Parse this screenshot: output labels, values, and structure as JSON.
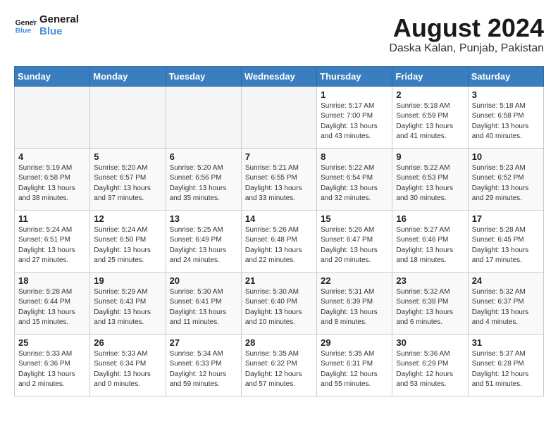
{
  "header": {
    "logo_text_general": "General",
    "logo_text_blue": "Blue",
    "month_year": "August 2024",
    "location": "Daska Kalan, Punjab, Pakistan"
  },
  "days_of_week": [
    "Sunday",
    "Monday",
    "Tuesday",
    "Wednesday",
    "Thursday",
    "Friday",
    "Saturday"
  ],
  "weeks": [
    [
      {
        "num": "",
        "info": ""
      },
      {
        "num": "",
        "info": ""
      },
      {
        "num": "",
        "info": ""
      },
      {
        "num": "",
        "info": ""
      },
      {
        "num": "1",
        "info": "Sunrise: 5:17 AM\nSunset: 7:00 PM\nDaylight: 13 hours\nand 43 minutes."
      },
      {
        "num": "2",
        "info": "Sunrise: 5:18 AM\nSunset: 6:59 PM\nDaylight: 13 hours\nand 41 minutes."
      },
      {
        "num": "3",
        "info": "Sunrise: 5:18 AM\nSunset: 6:58 PM\nDaylight: 13 hours\nand 40 minutes."
      }
    ],
    [
      {
        "num": "4",
        "info": "Sunrise: 5:19 AM\nSunset: 6:58 PM\nDaylight: 13 hours\nand 38 minutes."
      },
      {
        "num": "5",
        "info": "Sunrise: 5:20 AM\nSunset: 6:57 PM\nDaylight: 13 hours\nand 37 minutes."
      },
      {
        "num": "6",
        "info": "Sunrise: 5:20 AM\nSunset: 6:56 PM\nDaylight: 13 hours\nand 35 minutes."
      },
      {
        "num": "7",
        "info": "Sunrise: 5:21 AM\nSunset: 6:55 PM\nDaylight: 13 hours\nand 33 minutes."
      },
      {
        "num": "8",
        "info": "Sunrise: 5:22 AM\nSunset: 6:54 PM\nDaylight: 13 hours\nand 32 minutes."
      },
      {
        "num": "9",
        "info": "Sunrise: 5:22 AM\nSunset: 6:53 PM\nDaylight: 13 hours\nand 30 minutes."
      },
      {
        "num": "10",
        "info": "Sunrise: 5:23 AM\nSunset: 6:52 PM\nDaylight: 13 hours\nand 29 minutes."
      }
    ],
    [
      {
        "num": "11",
        "info": "Sunrise: 5:24 AM\nSunset: 6:51 PM\nDaylight: 13 hours\nand 27 minutes."
      },
      {
        "num": "12",
        "info": "Sunrise: 5:24 AM\nSunset: 6:50 PM\nDaylight: 13 hours\nand 25 minutes."
      },
      {
        "num": "13",
        "info": "Sunrise: 5:25 AM\nSunset: 6:49 PM\nDaylight: 13 hours\nand 24 minutes."
      },
      {
        "num": "14",
        "info": "Sunrise: 5:26 AM\nSunset: 6:48 PM\nDaylight: 13 hours\nand 22 minutes."
      },
      {
        "num": "15",
        "info": "Sunrise: 5:26 AM\nSunset: 6:47 PM\nDaylight: 13 hours\nand 20 minutes."
      },
      {
        "num": "16",
        "info": "Sunrise: 5:27 AM\nSunset: 6:46 PM\nDaylight: 13 hours\nand 18 minutes."
      },
      {
        "num": "17",
        "info": "Sunrise: 5:28 AM\nSunset: 6:45 PM\nDaylight: 13 hours\nand 17 minutes."
      }
    ],
    [
      {
        "num": "18",
        "info": "Sunrise: 5:28 AM\nSunset: 6:44 PM\nDaylight: 13 hours\nand 15 minutes."
      },
      {
        "num": "19",
        "info": "Sunrise: 5:29 AM\nSunset: 6:43 PM\nDaylight: 13 hours\nand 13 minutes."
      },
      {
        "num": "20",
        "info": "Sunrise: 5:30 AM\nSunset: 6:41 PM\nDaylight: 13 hours\nand 11 minutes."
      },
      {
        "num": "21",
        "info": "Sunrise: 5:30 AM\nSunset: 6:40 PM\nDaylight: 13 hours\nand 10 minutes."
      },
      {
        "num": "22",
        "info": "Sunrise: 5:31 AM\nSunset: 6:39 PM\nDaylight: 13 hours\nand 8 minutes."
      },
      {
        "num": "23",
        "info": "Sunrise: 5:32 AM\nSunset: 6:38 PM\nDaylight: 13 hours\nand 6 minutes."
      },
      {
        "num": "24",
        "info": "Sunrise: 5:32 AM\nSunset: 6:37 PM\nDaylight: 13 hours\nand 4 minutes."
      }
    ],
    [
      {
        "num": "25",
        "info": "Sunrise: 5:33 AM\nSunset: 6:36 PM\nDaylight: 13 hours\nand 2 minutes."
      },
      {
        "num": "26",
        "info": "Sunrise: 5:33 AM\nSunset: 6:34 PM\nDaylight: 13 hours\nand 0 minutes."
      },
      {
        "num": "27",
        "info": "Sunrise: 5:34 AM\nSunset: 6:33 PM\nDaylight: 12 hours\nand 59 minutes."
      },
      {
        "num": "28",
        "info": "Sunrise: 5:35 AM\nSunset: 6:32 PM\nDaylight: 12 hours\nand 57 minutes."
      },
      {
        "num": "29",
        "info": "Sunrise: 5:35 AM\nSunset: 6:31 PM\nDaylight: 12 hours\nand 55 minutes."
      },
      {
        "num": "30",
        "info": "Sunrise: 5:36 AM\nSunset: 6:29 PM\nDaylight: 12 hours\nand 53 minutes."
      },
      {
        "num": "31",
        "info": "Sunrise: 5:37 AM\nSunset: 6:28 PM\nDaylight: 12 hours\nand 51 minutes."
      }
    ]
  ]
}
